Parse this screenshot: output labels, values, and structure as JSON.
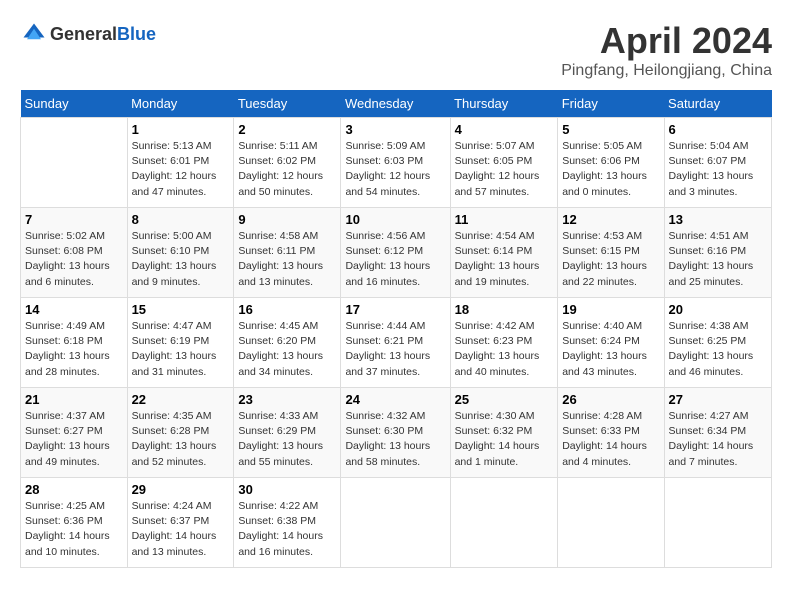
{
  "header": {
    "logo": {
      "general": "General",
      "blue": "Blue"
    },
    "title": "April 2024",
    "location": "Pingfang, Heilongjiang, China"
  },
  "calendar": {
    "days_of_week": [
      "Sunday",
      "Monday",
      "Tuesday",
      "Wednesday",
      "Thursday",
      "Friday",
      "Saturday"
    ],
    "weeks": [
      [
        {
          "day": "",
          "info": ""
        },
        {
          "day": "1",
          "info": "Sunrise: 5:13 AM\nSunset: 6:01 PM\nDaylight: 12 hours\nand 47 minutes."
        },
        {
          "day": "2",
          "info": "Sunrise: 5:11 AM\nSunset: 6:02 PM\nDaylight: 12 hours\nand 50 minutes."
        },
        {
          "day": "3",
          "info": "Sunrise: 5:09 AM\nSunset: 6:03 PM\nDaylight: 12 hours\nand 54 minutes."
        },
        {
          "day": "4",
          "info": "Sunrise: 5:07 AM\nSunset: 6:05 PM\nDaylight: 12 hours\nand 57 minutes."
        },
        {
          "day": "5",
          "info": "Sunrise: 5:05 AM\nSunset: 6:06 PM\nDaylight: 13 hours\nand 0 minutes."
        },
        {
          "day": "6",
          "info": "Sunrise: 5:04 AM\nSunset: 6:07 PM\nDaylight: 13 hours\nand 3 minutes."
        }
      ],
      [
        {
          "day": "7",
          "info": "Sunrise: 5:02 AM\nSunset: 6:08 PM\nDaylight: 13 hours\nand 6 minutes."
        },
        {
          "day": "8",
          "info": "Sunrise: 5:00 AM\nSunset: 6:10 PM\nDaylight: 13 hours\nand 9 minutes."
        },
        {
          "day": "9",
          "info": "Sunrise: 4:58 AM\nSunset: 6:11 PM\nDaylight: 13 hours\nand 13 minutes."
        },
        {
          "day": "10",
          "info": "Sunrise: 4:56 AM\nSunset: 6:12 PM\nDaylight: 13 hours\nand 16 minutes."
        },
        {
          "day": "11",
          "info": "Sunrise: 4:54 AM\nSunset: 6:14 PM\nDaylight: 13 hours\nand 19 minutes."
        },
        {
          "day": "12",
          "info": "Sunrise: 4:53 AM\nSunset: 6:15 PM\nDaylight: 13 hours\nand 22 minutes."
        },
        {
          "day": "13",
          "info": "Sunrise: 4:51 AM\nSunset: 6:16 PM\nDaylight: 13 hours\nand 25 minutes."
        }
      ],
      [
        {
          "day": "14",
          "info": "Sunrise: 4:49 AM\nSunset: 6:18 PM\nDaylight: 13 hours\nand 28 minutes."
        },
        {
          "day": "15",
          "info": "Sunrise: 4:47 AM\nSunset: 6:19 PM\nDaylight: 13 hours\nand 31 minutes."
        },
        {
          "day": "16",
          "info": "Sunrise: 4:45 AM\nSunset: 6:20 PM\nDaylight: 13 hours\nand 34 minutes."
        },
        {
          "day": "17",
          "info": "Sunrise: 4:44 AM\nSunset: 6:21 PM\nDaylight: 13 hours\nand 37 minutes."
        },
        {
          "day": "18",
          "info": "Sunrise: 4:42 AM\nSunset: 6:23 PM\nDaylight: 13 hours\nand 40 minutes."
        },
        {
          "day": "19",
          "info": "Sunrise: 4:40 AM\nSunset: 6:24 PM\nDaylight: 13 hours\nand 43 minutes."
        },
        {
          "day": "20",
          "info": "Sunrise: 4:38 AM\nSunset: 6:25 PM\nDaylight: 13 hours\nand 46 minutes."
        }
      ],
      [
        {
          "day": "21",
          "info": "Sunrise: 4:37 AM\nSunset: 6:27 PM\nDaylight: 13 hours\nand 49 minutes."
        },
        {
          "day": "22",
          "info": "Sunrise: 4:35 AM\nSunset: 6:28 PM\nDaylight: 13 hours\nand 52 minutes."
        },
        {
          "day": "23",
          "info": "Sunrise: 4:33 AM\nSunset: 6:29 PM\nDaylight: 13 hours\nand 55 minutes."
        },
        {
          "day": "24",
          "info": "Sunrise: 4:32 AM\nSunset: 6:30 PM\nDaylight: 13 hours\nand 58 minutes."
        },
        {
          "day": "25",
          "info": "Sunrise: 4:30 AM\nSunset: 6:32 PM\nDaylight: 14 hours\nand 1 minute."
        },
        {
          "day": "26",
          "info": "Sunrise: 4:28 AM\nSunset: 6:33 PM\nDaylight: 14 hours\nand 4 minutes."
        },
        {
          "day": "27",
          "info": "Sunrise: 4:27 AM\nSunset: 6:34 PM\nDaylight: 14 hours\nand 7 minutes."
        }
      ],
      [
        {
          "day": "28",
          "info": "Sunrise: 4:25 AM\nSunset: 6:36 PM\nDaylight: 14 hours\nand 10 minutes."
        },
        {
          "day": "29",
          "info": "Sunrise: 4:24 AM\nSunset: 6:37 PM\nDaylight: 14 hours\nand 13 minutes."
        },
        {
          "day": "30",
          "info": "Sunrise: 4:22 AM\nSunset: 6:38 PM\nDaylight: 14 hours\nand 16 minutes."
        },
        {
          "day": "",
          "info": ""
        },
        {
          "day": "",
          "info": ""
        },
        {
          "day": "",
          "info": ""
        },
        {
          "day": "",
          "info": ""
        }
      ]
    ]
  }
}
